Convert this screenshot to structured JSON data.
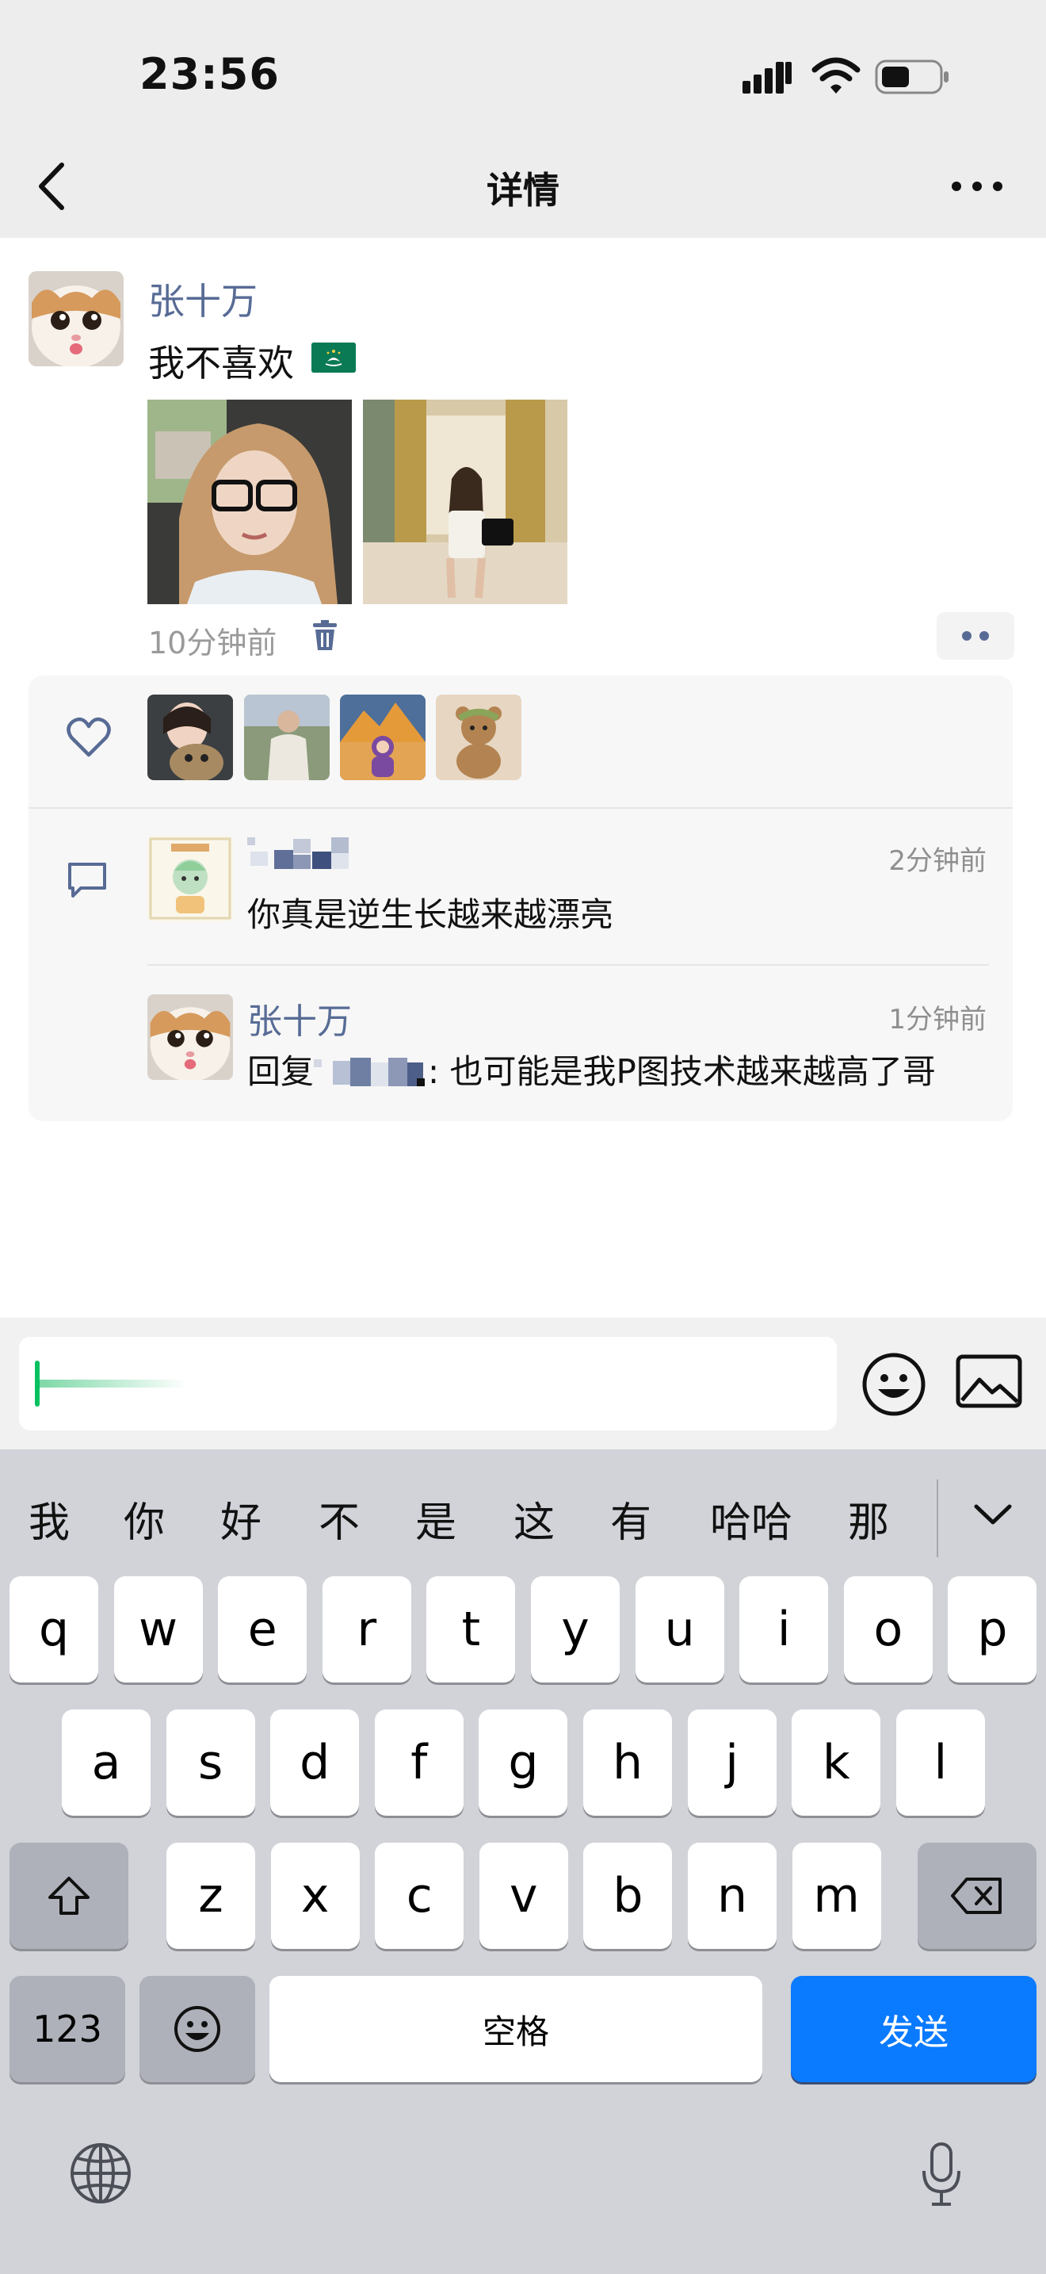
{
  "status_bar": {
    "time": "23:56"
  },
  "nav": {
    "title": "详情"
  },
  "post": {
    "author": "张十万",
    "text": "我不喜欢",
    "time": "10分钟前"
  },
  "comments": [
    {
      "time": "2分钟前",
      "text": "你真是逆生长越来越漂亮"
    },
    {
      "author": "张十万",
      "time": "1分钟前",
      "reply_prefix": "回复",
      "reply_text": ": 也可能是我P图技术越来越高了哥"
    }
  ],
  "input": {
    "value": ""
  },
  "keyboard": {
    "suggestions": [
      "我",
      "你",
      "好",
      "不",
      "是",
      "这",
      "有",
      "哈哈",
      "那"
    ],
    "row1": [
      "q",
      "w",
      "e",
      "r",
      "t",
      "y",
      "u",
      "i",
      "o",
      "p"
    ],
    "row2": [
      "a",
      "s",
      "d",
      "f",
      "g",
      "h",
      "j",
      "k",
      "l"
    ],
    "row3": [
      "z",
      "x",
      "c",
      "v",
      "b",
      "n",
      "m"
    ],
    "numbers_label": "123",
    "space_label": "空格",
    "send_label": "发送"
  },
  "colors": {
    "link": "#576b95",
    "send": "#0a7aff",
    "accent_green": "#07c160"
  },
  "icons": [
    "back-icon",
    "more-icon",
    "delete-icon",
    "heart-icon",
    "comment-icon",
    "emoji-icon",
    "image-icon",
    "shift-icon",
    "backspace-icon",
    "globe-icon",
    "mic-icon",
    "chevron-down-icon"
  ]
}
